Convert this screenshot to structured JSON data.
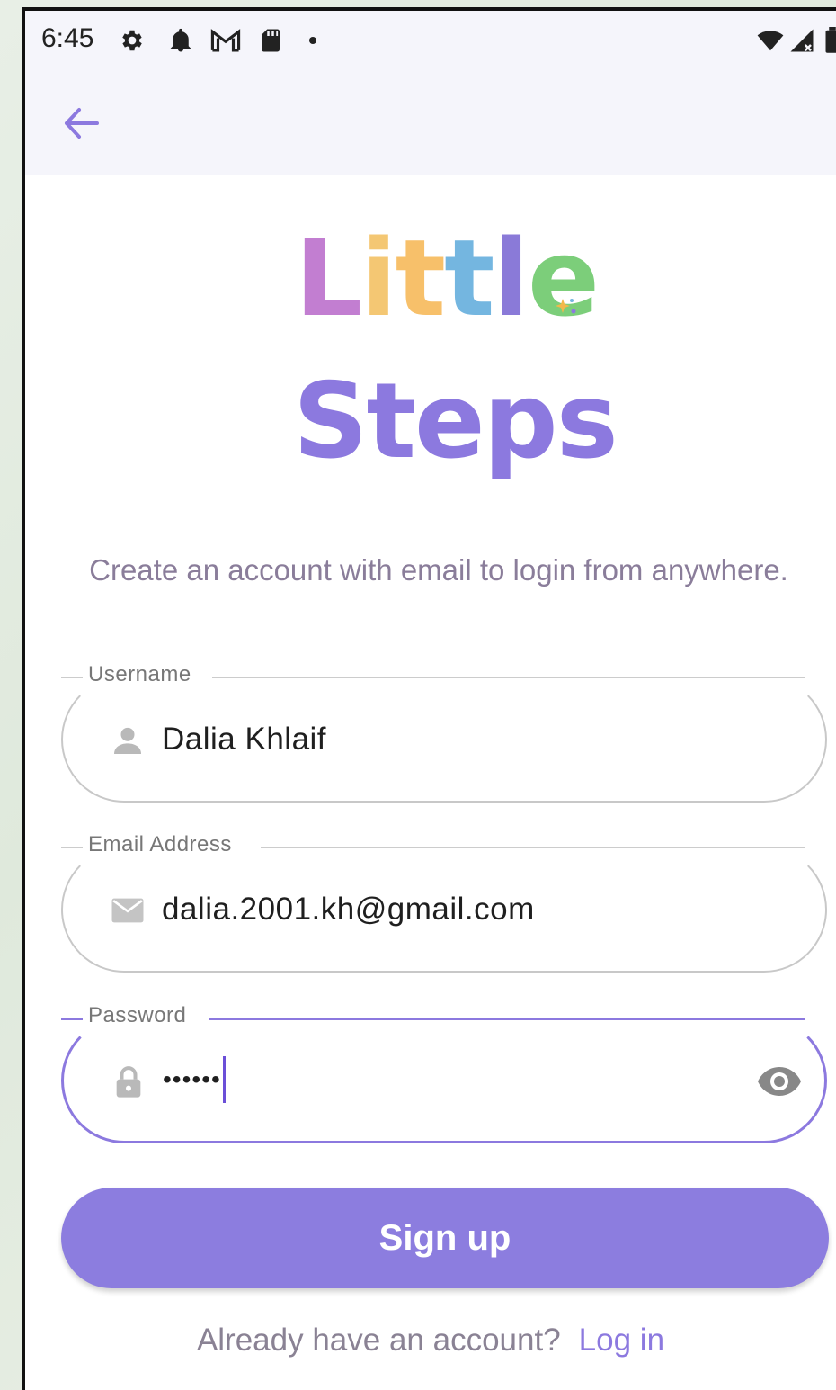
{
  "status_bar": {
    "time": "6:45",
    "icons": [
      "gear-icon",
      "bell-icon",
      "gmail-icon",
      "sd-card-icon",
      "dot-icon",
      "wifi-icon",
      "signal-icon",
      "battery-icon"
    ]
  },
  "app_bar": {
    "back_icon": "arrow-left-icon"
  },
  "logo": {
    "line1": [
      "L",
      "i",
      "t",
      "t",
      "l",
      "e"
    ],
    "line1_colors": [
      "#c27ed1",
      "#f7c06a",
      "#f4c773",
      "#74b6e0",
      "#74b6e0",
      "#7cce7a"
    ],
    "line2": "Steps",
    "line2_color": "#8c79df"
  },
  "subtitle": "Create an account with email to login from anywhere.",
  "fields": {
    "username": {
      "label": "Username",
      "value": "Dalia Khlaif",
      "icon": "person-icon"
    },
    "email": {
      "label": "Email Address",
      "value": "dalia.2001.kh@gmail.com",
      "icon": "mail-icon"
    },
    "password": {
      "label": "Password",
      "value": "••••••",
      "icon": "lock-icon",
      "toggle_icon": "eye-icon"
    }
  },
  "signup_button": "Sign up",
  "footer": {
    "prompt": "Already have an account?",
    "link": "Log in"
  },
  "colors": {
    "accent": "#8c79df",
    "button": "#8c7ddf",
    "app_bar_bg": "#f5f5fb"
  }
}
